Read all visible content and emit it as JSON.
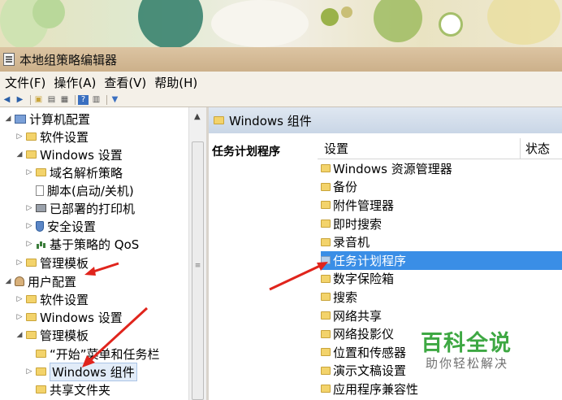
{
  "window": {
    "title": "本地组策略编辑器"
  },
  "menu": [
    "文件(F)",
    "操作(A)",
    "查看(V)",
    "帮助(H)"
  ],
  "toolbar_icons": [
    "back-icon",
    "forward-icon",
    "up-folder-icon",
    "show-tree-icon",
    "export-icon",
    "help-icon",
    "properties-icon",
    "filter-icon"
  ],
  "tree": [
    {
      "label": "计算机配置",
      "icon": "computer-icon",
      "level": 0,
      "expanded": true
    },
    {
      "label": "软件设置",
      "icon": "folder-icon",
      "level": 1,
      "expanded": false
    },
    {
      "label": "Windows 设置",
      "icon": "folder-icon",
      "level": 1,
      "expanded": true
    },
    {
      "label": "域名解析策略",
      "icon": "folder-icon",
      "level": 2,
      "expanded": false
    },
    {
      "label": "脚本(启动/关机)",
      "icon": "document-icon",
      "level": 2,
      "expanded": false
    },
    {
      "label": "已部署的打印机",
      "icon": "printer-icon",
      "level": 2,
      "expanded": false
    },
    {
      "label": "安全设置",
      "icon": "security-icon",
      "level": 2,
      "expanded": false
    },
    {
      "label": "基于策略的 QoS",
      "icon": "chart-icon",
      "level": 2,
      "expanded": false
    },
    {
      "label": "管理模板",
      "icon": "folder-icon",
      "level": 1,
      "expanded": false
    },
    {
      "label": "用户配置",
      "icon": "user-icon",
      "level": 0,
      "expanded": true
    },
    {
      "label": "软件设置",
      "icon": "folder-icon",
      "level": 1,
      "expanded": false
    },
    {
      "label": "Windows 设置",
      "icon": "folder-icon",
      "level": 1,
      "expanded": false
    },
    {
      "label": "管理模板",
      "icon": "folder-icon",
      "level": 1,
      "expanded": true
    },
    {
      "label": "“开始”菜单和任务栏",
      "icon": "folder-icon",
      "level": 2,
      "expanded": false
    },
    {
      "label": "Windows 组件",
      "icon": "folder-icon",
      "level": 2,
      "expanded": false,
      "selected": true
    },
    {
      "label": "共享文件夹",
      "icon": "folder-icon",
      "level": 2,
      "expanded": false
    }
  ],
  "right": {
    "header": "Windows 组件",
    "description_title": "任务计划程序",
    "columns": [
      "设置",
      "状态"
    ],
    "items": [
      "Windows 资源管理器",
      "备份",
      "附件管理器",
      "即时搜索",
      "录音机",
      "任务计划程序",
      "数字保险箱",
      "搜索",
      "网络共享",
      "网络投影仪",
      "位置和传感器",
      "演示文稿设置",
      "应用程序兼容性"
    ],
    "selected_index": 5
  },
  "watermark": {
    "brand": "百科全说",
    "slogan": "助你轻松解决"
  },
  "colors": {
    "selection": "#3a8ee6",
    "arrow": "#e0241c",
    "watermark_green": "#3ea843"
  }
}
